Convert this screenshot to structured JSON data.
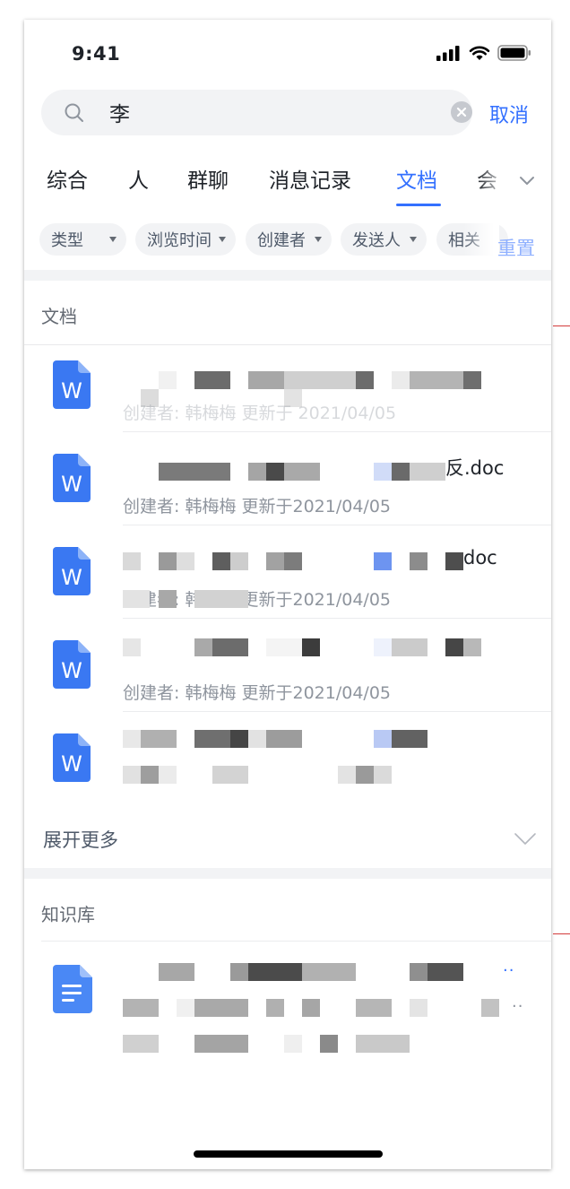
{
  "status_bar": {
    "time": "9:41"
  },
  "search": {
    "query": "李",
    "cancel_label": "取消"
  },
  "tabs": [
    {
      "label": "综合",
      "active": false
    },
    {
      "label": "人",
      "active": false
    },
    {
      "label": "群聊",
      "active": false
    },
    {
      "label": "消息记录",
      "active": false
    },
    {
      "label": "文档",
      "active": true
    },
    {
      "label": "会",
      "active": false
    }
  ],
  "filters": {
    "chips": [
      "类型",
      "浏览时间",
      "创建者",
      "发送人",
      "相关"
    ],
    "reset_label": "重置"
  },
  "documents": {
    "section_title": "文档",
    "items": [
      {
        "title": "",
        "meta": "创建者: 韩梅梅   更新于 2021/04/05",
        "icon": "word-doc-icon"
      },
      {
        "title": "反.doc",
        "meta": "创建者: 韩梅梅   更新于2021/04/05",
        "icon": "word-doc-icon"
      },
      {
        "title": "doc",
        "meta": "创建者: 韩梅梅   更新于2021/04/05",
        "icon": "word-doc-icon"
      },
      {
        "title": "",
        "meta": "创建者: 韩梅梅   更新于2021/04/05",
        "icon": "word-doc-icon"
      },
      {
        "title": "",
        "meta": "",
        "icon": "word-doc-icon"
      }
    ],
    "expand_label": "展开更多"
  },
  "knowledge_base": {
    "section_title": "知识库",
    "items": [
      {
        "icon": "doc-file-icon",
        "title": "",
        "snippet": ""
      }
    ]
  },
  "colors": {
    "accent": "#3370ff",
    "word_icon": "#3a78f2",
    "text_primary": "#1f2329",
    "text_secondary": "#8f959e",
    "section_gap": "#f2f3f5"
  }
}
